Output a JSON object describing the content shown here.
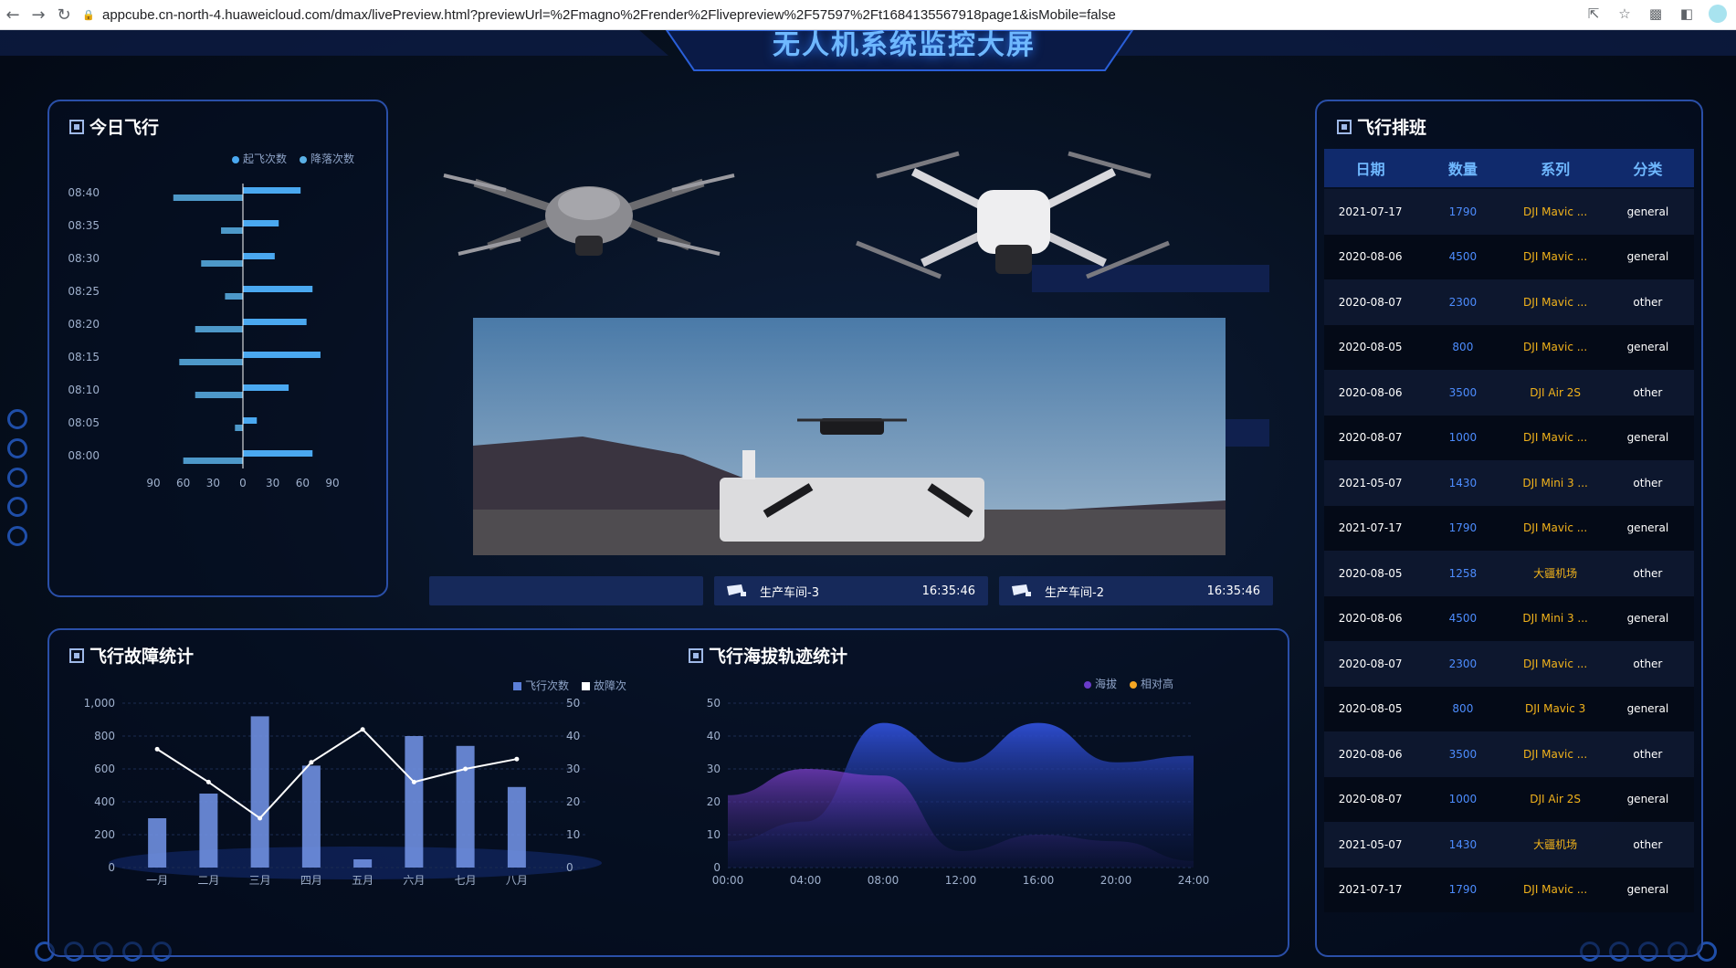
{
  "browser": {
    "url": "appcube.cn-north-4.huaweicloud.com/dmax/livePreview.html?previewUrl=%2Fmagno%2Frender%2Flivepreview%2F57597%2Ft1684135567918page1&isMobile=false"
  },
  "header": {
    "title": "无人机系统监控大屏"
  },
  "today_flight": {
    "title": "今日飞行",
    "legend": [
      "起飞次数",
      "降落次数"
    ],
    "colors": {
      "takeoff": "#4aa8f0",
      "landing": "#5ab0e6"
    },
    "chart_data": {
      "type": "bar",
      "orientation": "horizontal-butterfly",
      "categories": [
        "08:40",
        "08:35",
        "08:30",
        "08:25",
        "08:20",
        "08:15",
        "08:10",
        "08:05",
        "08:00"
      ],
      "series": [
        {
          "name": "起飞次数",
          "values": [
            58,
            36,
            32,
            70,
            64,
            78,
            46,
            14,
            70
          ]
        },
        {
          "name": "降落次数",
          "values": [
            70,
            22,
            42,
            18,
            48,
            64,
            48,
            8,
            60
          ]
        }
      ],
      "xlim": [
        -90,
        90
      ],
      "x_ticks": [
        "90",
        "60",
        "30",
        "0",
        "30",
        "60",
        "90"
      ]
    }
  },
  "center": {
    "feeds": [
      {
        "label": "",
        "time": ""
      },
      {
        "label": "生产车间-3",
        "time": "16:35:46"
      },
      {
        "label": "生产车间-2",
        "time": "16:35:46"
      }
    ]
  },
  "fault_stats": {
    "title": "飞行故障统计",
    "legend": [
      "飞行次数",
      "故障次"
    ],
    "chart_data": {
      "type": "bar",
      "categories": [
        "一月",
        "二月",
        "三月",
        "四月",
        "五月",
        "六月",
        "七月",
        "八月"
      ],
      "series": [
        {
          "name": "飞行次数",
          "type": "bar",
          "values": [
            300,
            450,
            920,
            620,
            50,
            800,
            740,
            490
          ]
        },
        {
          "name": "故障次",
          "type": "line",
          "values": [
            36,
            26,
            15,
            32,
            42,
            26,
            30,
            33
          ]
        }
      ],
      "ylim_left": [
        0,
        1000
      ],
      "ylim_right": [
        0,
        50
      ],
      "y_ticks_left": [
        "0",
        "200",
        "400",
        "600",
        "800",
        "1,000"
      ],
      "y_ticks_right": [
        "0",
        "10",
        "20",
        "30",
        "40",
        "50"
      ]
    }
  },
  "altitude": {
    "title": "飞行海拔轨迹统计",
    "legend": [
      "海拔",
      "相对高"
    ],
    "colors": {
      "altitude": "#6a3cc9",
      "relative": "#f5a623"
    },
    "chart_data": {
      "type": "area",
      "x": [
        "00:00",
        "04:00",
        "08:00",
        "12:00",
        "16:00",
        "20:00",
        "24:00"
      ],
      "series": [
        {
          "name": "海拔",
          "values": [
            22,
            30,
            28,
            5,
            10,
            8,
            2
          ]
        },
        {
          "name": "相对高",
          "values": [
            8,
            14,
            44,
            32,
            44,
            32,
            34
          ]
        }
      ],
      "ylim": [
        0,
        50
      ],
      "y_ticks": [
        "0",
        "10",
        "20",
        "30",
        "40",
        "50"
      ]
    }
  },
  "schedule": {
    "title": "飞行排班",
    "columns": [
      "日期",
      "数量",
      "系列",
      "分类"
    ],
    "rows": [
      [
        "2021-07-17",
        "1790",
        "DJI Mavic ...",
        "general"
      ],
      [
        "2020-08-06",
        "4500",
        "DJI Mavic ...",
        "general"
      ],
      [
        "2020-08-07",
        "2300",
        "DJI Mavic ...",
        "other"
      ],
      [
        "2020-08-05",
        "800",
        "DJI Mavic ...",
        "general"
      ],
      [
        "2020-08-06",
        "3500",
        "DJI Air 2S",
        "other"
      ],
      [
        "2020-08-07",
        "1000",
        "DJI Mavic ...",
        "general"
      ],
      [
        "2021-05-07",
        "1430",
        "DJI Mini 3 ...",
        "other"
      ],
      [
        "2021-07-17",
        "1790",
        "DJI Mavic ...",
        "general"
      ],
      [
        "2020-08-05",
        "1258",
        "大疆机场",
        "other"
      ],
      [
        "2020-08-06",
        "4500",
        "DJI Mini 3 ...",
        "general"
      ],
      [
        "2020-08-07",
        "2300",
        "DJI Mavic ...",
        "other"
      ],
      [
        "2020-08-05",
        "800",
        "DJI Mavic 3",
        "general"
      ],
      [
        "2020-08-06",
        "3500",
        "DJI Mavic ...",
        "other"
      ],
      [
        "2020-08-07",
        "1000",
        "DJI Air 2S",
        "general"
      ],
      [
        "2021-05-07",
        "1430",
        "大疆机场",
        "other"
      ],
      [
        "2021-07-17",
        "1790",
        "DJI Mavic ...",
        "general"
      ]
    ]
  }
}
